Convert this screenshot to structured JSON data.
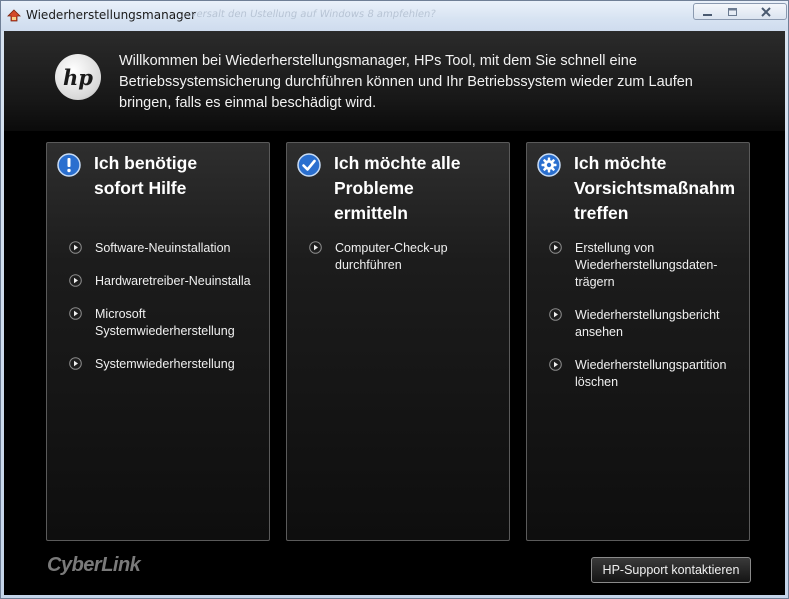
{
  "window": {
    "title": "Wiederherstellungsmanager",
    "ghost_text": "...versalt den Ustellung auf Windows 8 ampfehlen?"
  },
  "header": {
    "logo_text": "hp",
    "welcome_line1": "Willkommen bei Wiederherstellungsmanager, HPs Tool, mit dem Sie schnell eine",
    "welcome_line2": "Betriebssystemsicherung durchführen können und Ihr Betriebssystem wieder zum Laufen",
    "welcome_line3": "bringen, falls es einmal beschädigt wird."
  },
  "panels": [
    {
      "icon": "exclamation-icon",
      "title_lines": [
        "Ich benötige",
        "sofort Hilfe"
      ],
      "items": [
        {
          "lines": [
            "Software-Neuinstallation"
          ]
        },
        {
          "lines": [
            "Hardwaretreiber-Neuinstalla"
          ]
        },
        {
          "lines": [
            "Microsoft",
            "Systemwiederherstellung"
          ]
        },
        {
          "lines": [
            "Systemwiederherstellung"
          ]
        }
      ]
    },
    {
      "icon": "checkmark-icon",
      "title_lines": [
        "Ich möchte alle",
        "Probleme",
        "ermitteln"
      ],
      "items": [
        {
          "lines": [
            "Computer-Check-up",
            "durchführen"
          ]
        }
      ]
    },
    {
      "icon": "gear-icon",
      "title_lines": [
        "Ich möchte",
        "Vorsichtsmaßnahm",
        "treffen"
      ],
      "items": [
        {
          "lines": [
            "Erstellung von",
            "Wiederherstellungsdaten-",
            "trägern"
          ]
        },
        {
          "lines": [
            "Wiederherstellungsbericht",
            "ansehen"
          ]
        },
        {
          "lines": [
            "Wiederherstellungspartition",
            "löschen"
          ]
        }
      ]
    }
  ],
  "footer": {
    "brand": "CyberLink",
    "support_button": "HP-Support kontaktieren"
  },
  "colors": {
    "icon_blue": "#2a6fcf",
    "background": "#000000",
    "text": "#f0f0f0"
  }
}
